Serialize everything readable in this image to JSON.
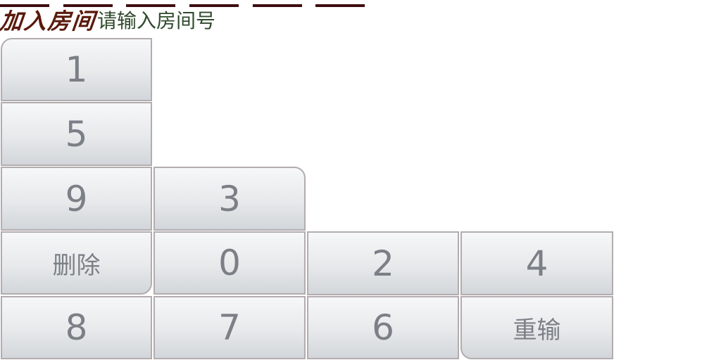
{
  "header": {
    "title": "加入房间",
    "subtitle": "请输入房间号",
    "code_slot_count": 6
  },
  "keypad": {
    "keys": [
      {
        "label": "1",
        "name": "key-1",
        "kind": "num"
      },
      {
        "label": "5",
        "name": "key-5",
        "kind": "num"
      },
      {
        "label": "9",
        "name": "key-9",
        "kind": "num"
      },
      {
        "label": "3",
        "name": "key-3",
        "kind": "num"
      },
      {
        "label": "删除",
        "name": "delete-button",
        "kind": "txt"
      },
      {
        "label": "0",
        "name": "key-0",
        "kind": "num"
      },
      {
        "label": "2",
        "name": "key-2",
        "kind": "num"
      },
      {
        "label": "4",
        "name": "key-4",
        "kind": "num"
      },
      {
        "label": "8",
        "name": "key-8",
        "kind": "num"
      },
      {
        "label": "7",
        "name": "key-7",
        "kind": "num"
      },
      {
        "label": "6",
        "name": "key-6",
        "kind": "num"
      },
      {
        "label": "重输",
        "name": "reset-button",
        "kind": "txt"
      }
    ]
  },
  "colors": {
    "slot": "#3e0d10",
    "title": "#5a1a0c",
    "subtitle": "#2f4a2c",
    "key_border": "#b3acae",
    "key_text": "#7b7f86"
  }
}
